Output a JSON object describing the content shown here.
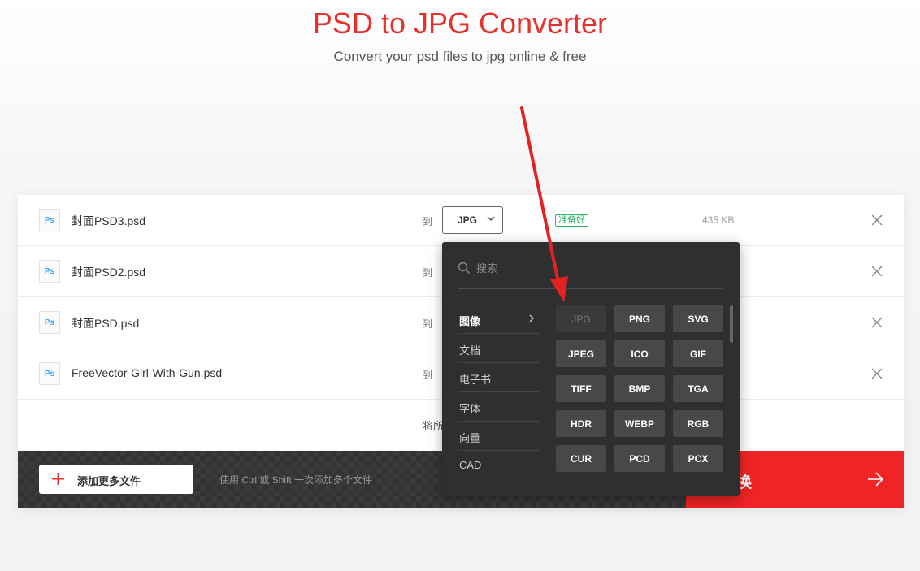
{
  "header": {
    "title": "PSD to JPG Converter",
    "subtitle": "Convert your psd files to jpg online & free"
  },
  "files": [
    {
      "name": "封面PSD3.psd",
      "icon": "Ps",
      "to": "到",
      "format": "JPG",
      "status": "准备好",
      "size": "435 KB"
    },
    {
      "name": "封面PSD2.psd",
      "icon": "Ps",
      "to": "到"
    },
    {
      "name": "封面PSD.psd",
      "icon": "Ps",
      "to": "到"
    },
    {
      "name": "FreeVector-Girl-With-Gun.psd",
      "icon": "Ps",
      "to": "到"
    }
  ],
  "convert_all_label": "将所",
  "bottom_bar": {
    "add_files_label": "添加更多文件",
    "hint": "使用 Ctrl 或 Shift 一次添加多个文件",
    "convert_label": "换"
  },
  "dropdown": {
    "search_placeholder": "搜索",
    "categories": [
      "图像",
      "文档",
      "电子书",
      "字体",
      "向量",
      "CAD"
    ],
    "active_category": "图像",
    "formats": [
      "JPG",
      "PNG",
      "SVG",
      "JPEG",
      "ICO",
      "GIF",
      "TIFF",
      "BMP",
      "TGA",
      "HDR",
      "WEBP",
      "RGB",
      "CUR",
      "PCD",
      "PCX"
    ],
    "disabled_format": "JPG"
  },
  "colors": {
    "brand_red": "#e5322d",
    "convert_red": "#f02424",
    "status_green": "#2eb86b",
    "ps_blue": "#31a8ff"
  }
}
